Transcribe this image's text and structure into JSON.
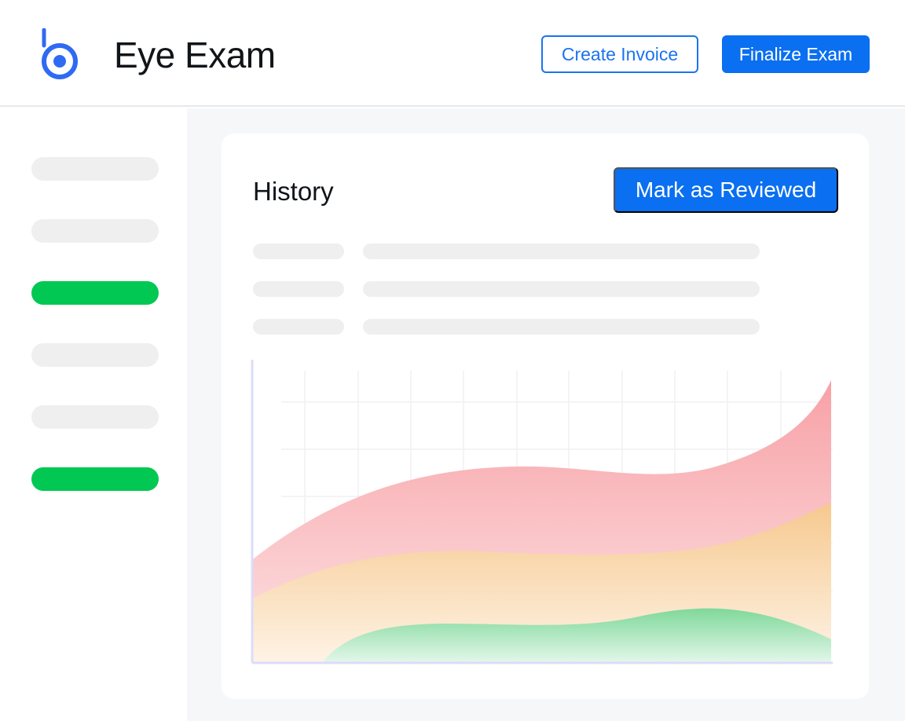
{
  "header": {
    "title": "Eye Exam",
    "create_invoice_label": "Create Invoice",
    "finalize_exam_label": "Finalize Exam"
  },
  "sidebar": {
    "items": [
      {
        "active": false
      },
      {
        "active": false
      },
      {
        "active": true
      },
      {
        "active": false
      },
      {
        "active": false
      },
      {
        "active": true
      }
    ]
  },
  "card": {
    "title": "History",
    "mark_reviewed_label": "Mark as Reviewed"
  },
  "colors": {
    "primary": "#0a6ff0",
    "active_green": "#00c853",
    "series_red": "#f7a1a6",
    "series_orange": "#f6c98f",
    "series_green": "#7fd89a"
  }
}
